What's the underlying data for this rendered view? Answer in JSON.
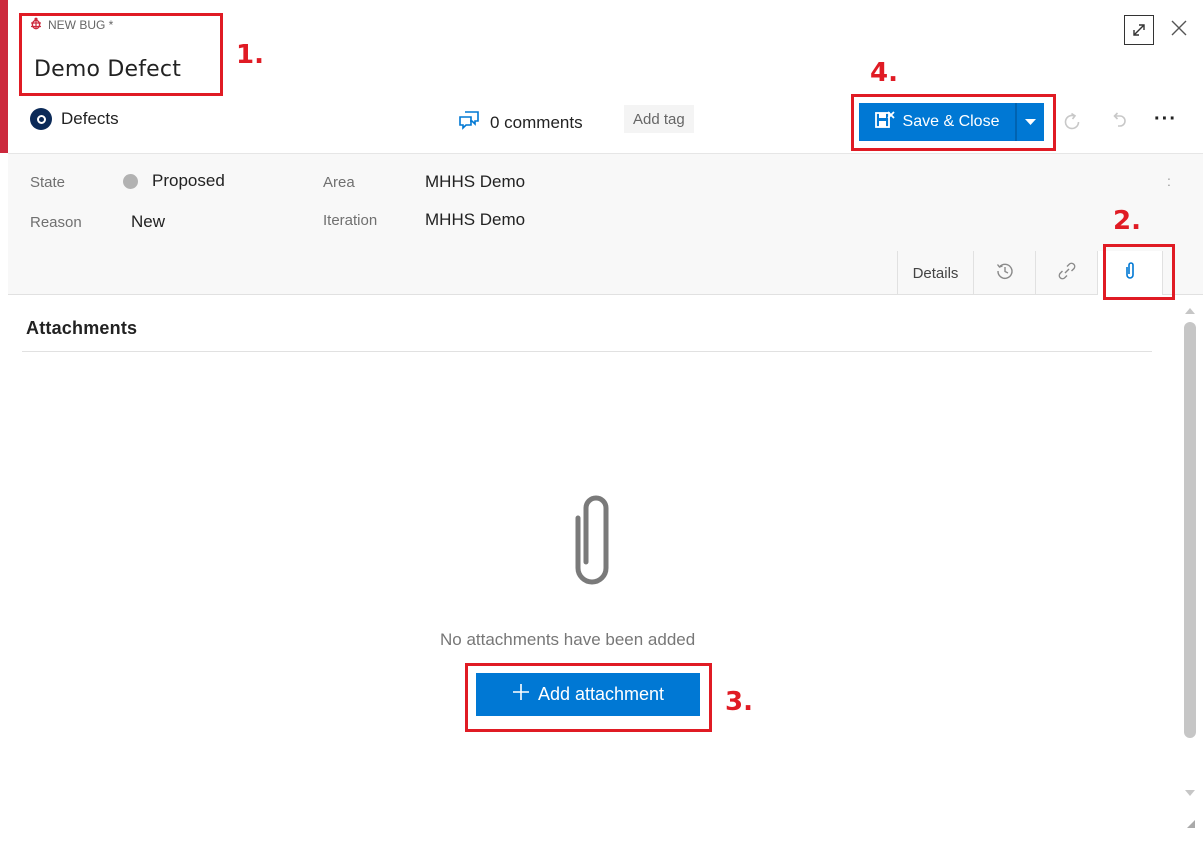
{
  "work_item": {
    "type_label": "NEW BUG *",
    "title": "Demo Defect",
    "team": "Defects"
  },
  "header": {
    "comments": "0 comments",
    "add_tag": "Add tag",
    "save_close": "Save & Close",
    "more": "···"
  },
  "fields": {
    "state_label": "State",
    "state_value": "Proposed",
    "reason_label": "Reason",
    "reason_value": "New",
    "area_label": "Area",
    "area_value": "MHHS Demo",
    "iteration_label": "Iteration",
    "iteration_value": "MHHS Demo"
  },
  "tabs": {
    "details": "Details",
    "history_icon": "history-icon",
    "links_icon": "link-icon",
    "attachments_icon": "paperclip-icon",
    "active": "attachments"
  },
  "attachments": {
    "heading": "Attachments",
    "empty_message": "No attachments have been added",
    "add_button": "Add attachment"
  },
  "annotations": [
    "1.",
    "2.",
    "3.",
    "4."
  ],
  "colors": {
    "accent_bug": "#cc293d",
    "primary": "#0078d4",
    "annotation": "#e01b24",
    "team_avatar": "#0b2a58"
  }
}
